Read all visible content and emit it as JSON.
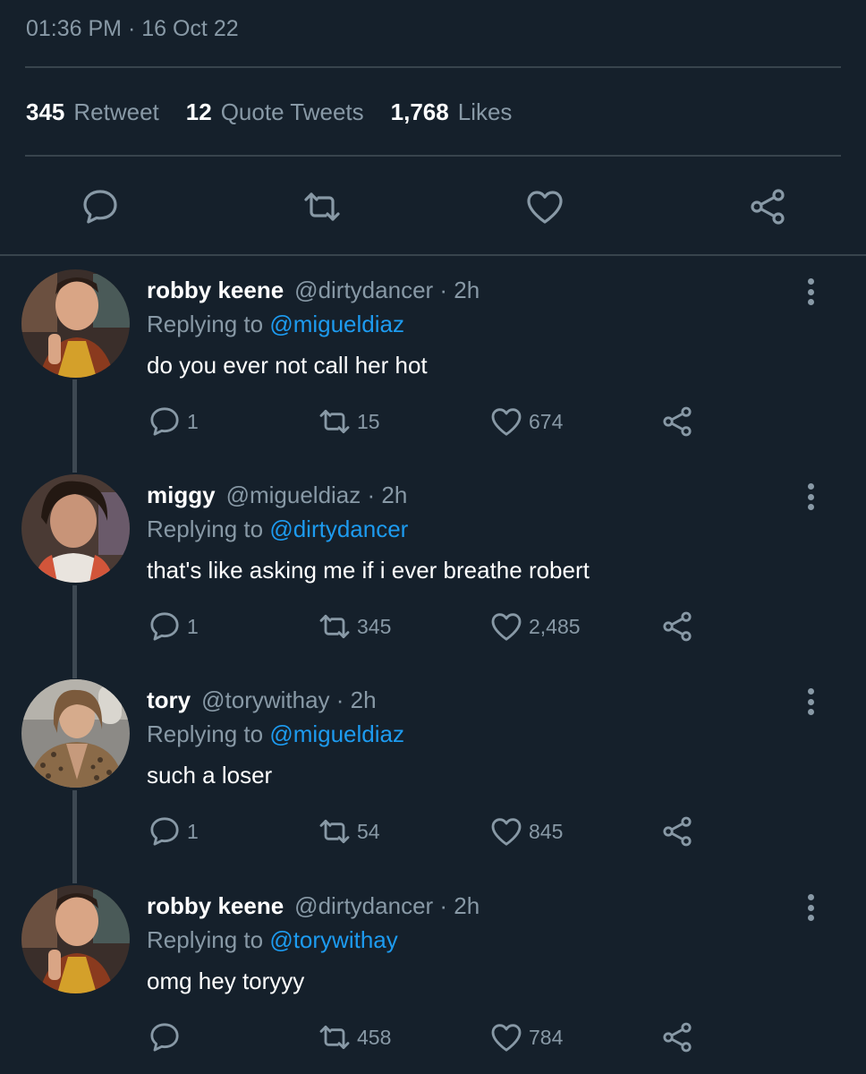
{
  "meta": {
    "timestamp": "01:36 PM · 16 Oct 22"
  },
  "stats": {
    "retweets_num": "345",
    "retweets_label": "Retweet",
    "quotes_num": "12",
    "quotes_label": "Quote Tweets",
    "likes_num": "1,768",
    "likes_label": "Likes"
  },
  "colors": {
    "background": "#15202b",
    "muted": "#8899a6",
    "accent": "#1d9bf0",
    "divider": "#38444d"
  },
  "icons": [
    "reply-icon",
    "retweet-icon",
    "like-icon",
    "share-icon",
    "more-icon"
  ],
  "replies": [
    {
      "name": "robby keene",
      "handle": "@dirtydancer · 2h",
      "replying_label": "Replying to",
      "replying_to": "@migueldiaz",
      "text": "do you ever not call her hot",
      "replies": "1",
      "retweets": "15",
      "likes": "674"
    },
    {
      "name": "miggy",
      "handle": "@migueldiaz · 2h",
      "replying_label": "Replying to",
      "replying_to": "@dirtydancer",
      "text": "that's like asking me if i ever breathe robert",
      "replies": "1",
      "retweets": "345",
      "likes": "2,485"
    },
    {
      "name": "tory",
      "handle": "@torywithay · 2h",
      "replying_label": "Replying to",
      "replying_to": "@migueldiaz",
      "text": "such a loser",
      "replies": "1",
      "retweets": "54",
      "likes": "845"
    },
    {
      "name": "robby keene",
      "handle": "@dirtydancer · 2h",
      "replying_label": "Replying to",
      "replying_to": "@torywithay",
      "text": "omg hey toryyy",
      "replies": "",
      "retweets": "458",
      "likes": "784"
    }
  ]
}
